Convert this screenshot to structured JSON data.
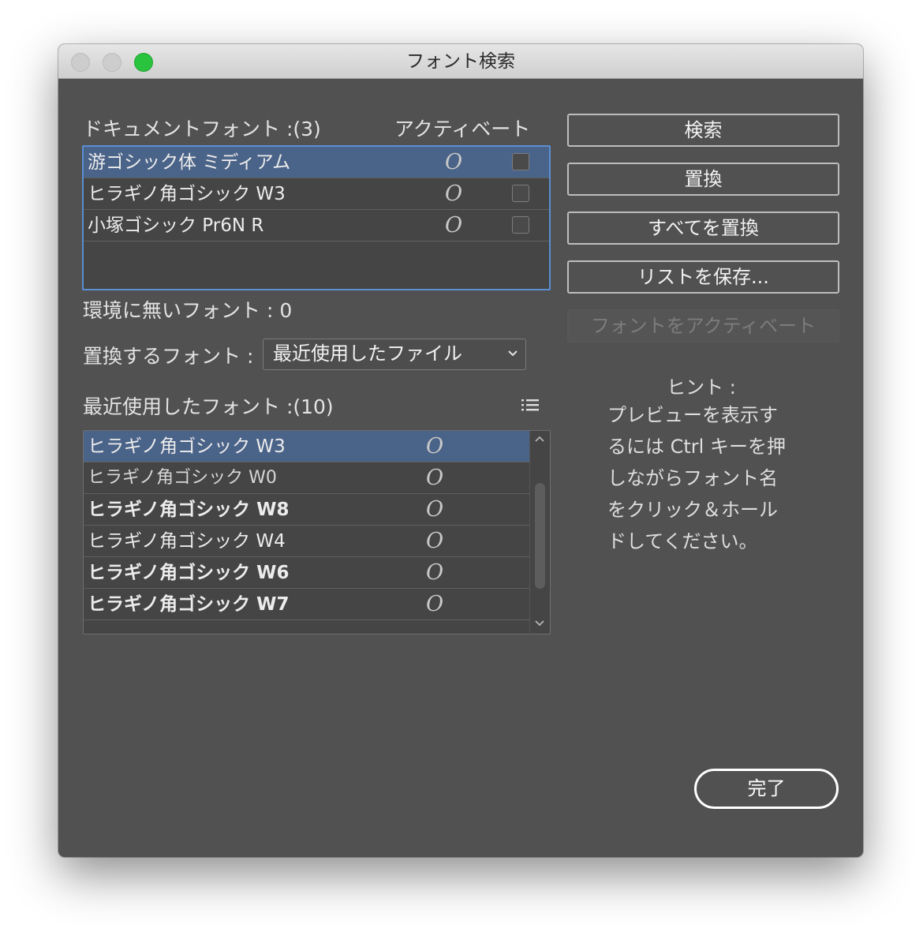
{
  "window": {
    "title": "フォント検索"
  },
  "document_fonts": {
    "header": "ドキュメントフォント :(3)",
    "activate_header": "アクティベート",
    "items": [
      {
        "name": "游ゴシック体 ミディアム",
        "type_glyph": "O",
        "selected": true
      },
      {
        "name": "ヒラギノ角ゴシック W3",
        "type_glyph": "O",
        "selected": false
      },
      {
        "name": "小塚ゴシック Pr6N R",
        "type_glyph": "O",
        "selected": false
      }
    ]
  },
  "missing_fonts": {
    "label": "環境に無いフォント : 0"
  },
  "replace_with": {
    "label": "置換するフォント :",
    "value": "最近使用したファイル"
  },
  "recent_fonts": {
    "header": "最近使用したフォント :(10)",
    "list_icon": "list-icon",
    "items": [
      {
        "name": "ヒラギノ角ゴシック W3",
        "type_glyph": "O",
        "weight": "normal",
        "selected": true
      },
      {
        "name": "ヒラギノ角ゴシック W0",
        "type_glyph": "O",
        "weight": "thin",
        "selected": false
      },
      {
        "name": "ヒラギノ角ゴシック W8",
        "type_glyph": "O",
        "weight": "bold",
        "selected": false
      },
      {
        "name": "ヒラギノ角ゴシック W4",
        "type_glyph": "O",
        "weight": "normal",
        "selected": false
      },
      {
        "name": "ヒラギノ角ゴシック W6",
        "type_glyph": "O",
        "weight": "bold",
        "selected": false
      },
      {
        "name": "ヒラギノ角ゴシック W7",
        "type_glyph": "O",
        "weight": "bold",
        "selected": false
      }
    ]
  },
  "buttons": {
    "search": "検索",
    "replace": "置換",
    "replace_all": "すべてを置換",
    "save_list": "リストを保存...",
    "activate_font": "フォントをアクティベート",
    "done": "完了"
  },
  "hint": {
    "title": "ヒント :",
    "body": "プレビューを表示するには Ctrl キーを押しながらフォント名をクリック＆ホールドしてください。"
  },
  "colors": {
    "window_bg": "#515151",
    "selection": "#4a6388",
    "focus_border": "#5b8fd2",
    "zoom_button": "#29c33e"
  }
}
